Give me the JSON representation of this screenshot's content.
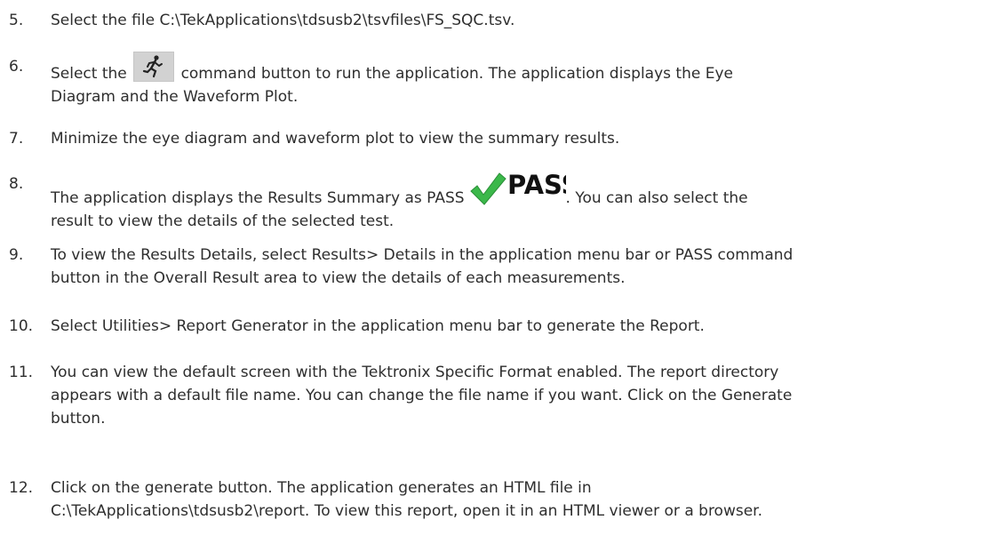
{
  "steps": [
    {
      "number": "5.",
      "line1": "Select the file C:\\TekApplications\\tdsusb2\\tsvfiles\\FS_SQC.tsv."
    },
    {
      "number": "6.",
      "pre": "Select the",
      "post": "command button to run the application. The application displays the Eye",
      "line2": "Diagram and the Waveform Plot.",
      "icon": "run-icon"
    },
    {
      "number": "7.",
      "line1": "Minimize the eye diagram and waveform plot to view the summary results."
    },
    {
      "number": "8.",
      "pre": "The application displays the Results Summary as PASS",
      "badge_text": "PASS",
      "badge_color": "#3bb84a",
      "post": ". You can also select the",
      "line2": "result to view the details of the selected test."
    },
    {
      "number": "9.",
      "line1": "To view the Results Details, select Results> Details in the application menu bar or PASS command",
      "line2": "button in the Overall Result area to view the details of each measurements."
    },
    {
      "number": "10.",
      "line1": "Select Utilities> Report Generator in the application menu bar to generate the Report."
    },
    {
      "number": "11.",
      "line1": "You can view the default screen with the Tektronix Specific Format enabled. The report directory",
      "line2": "appears with a default file name. You can change the file name if you want. Click on the Generate",
      "line3": "button."
    },
    {
      "number": "12.",
      "line1": "Click on the generate button. The application generates an HTML file in",
      "line2": "C:\\TekApplications\\tdsusb2\\report. To view this report, open it in an HTML viewer or a browser."
    }
  ]
}
